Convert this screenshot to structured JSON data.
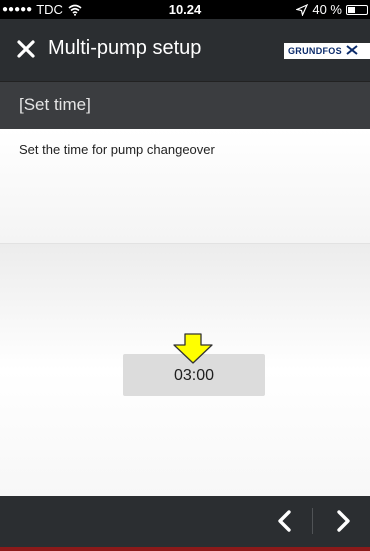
{
  "status_bar": {
    "signal": "●●●●●",
    "carrier": "TDC",
    "time": "10.24",
    "battery": "40 %",
    "battery_level": 0.4
  },
  "nav": {
    "title": "Multi-pump setup",
    "logo_text": "GRUNDFOS"
  },
  "section": {
    "title": "[Set time]"
  },
  "instruction": "Set the time for pump changeover",
  "time_value": "03:00",
  "colors": {
    "nav_bg": "#2b2e31",
    "section_bg": "#3b3d40",
    "field_bg": "#dcdcdc",
    "arrow": "#ffff00",
    "logo": "#0b2b6b"
  },
  "icons": {
    "close": "close-icon",
    "prev": "chevron-left-icon",
    "next": "chevron-right-icon",
    "arrow": "down-arrow-icon"
  }
}
